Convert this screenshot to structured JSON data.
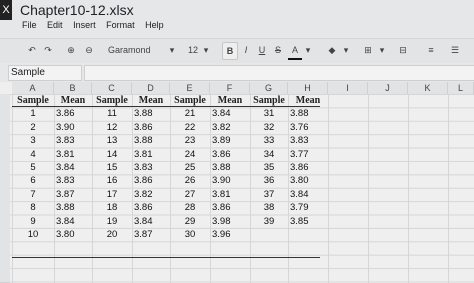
{
  "window": {
    "title": "Chapter10-12.xlsx",
    "app_icon": "X"
  },
  "menu": [
    "File",
    "Edit",
    "Insert",
    "Format",
    "Help"
  ],
  "toolbar": {
    "font": "Garamond",
    "font_size": "12",
    "bold": "B",
    "italic": "I",
    "underline": "U",
    "strike": "S",
    "font_color": "A"
  },
  "namebox": {
    "value": "Sample"
  },
  "columns": [
    "A",
    "B",
    "C",
    "D",
    "E",
    "F",
    "G",
    "H",
    "I",
    "J",
    "K",
    "L"
  ],
  "table": {
    "headers": [
      "Sample",
      "Mean",
      "Sample",
      "Mean",
      "Sample",
      "Mean",
      "Sample",
      "Mean"
    ],
    "rows": [
      [
        "1",
        "3.86",
        "11",
        "3.88",
        "21",
        "3.84",
        "31",
        "3.88"
      ],
      [
        "2",
        "3.90",
        "12",
        "3.86",
        "22",
        "3.82",
        "32",
        "3.76"
      ],
      [
        "3",
        "3.83",
        "13",
        "3.88",
        "23",
        "3.89",
        "33",
        "3.83"
      ],
      [
        "4",
        "3.81",
        "14",
        "3.81",
        "24",
        "3.86",
        "34",
        "3.77"
      ],
      [
        "5",
        "3.84",
        "15",
        "3.83",
        "25",
        "3.88",
        "35",
        "3.86"
      ],
      [
        "6",
        "3.83",
        "16",
        "3.86",
        "26",
        "3.90",
        "36",
        "3.80"
      ],
      [
        "7",
        "3.87",
        "17",
        "3.82",
        "27",
        "3.81",
        "37",
        "3.84"
      ],
      [
        "8",
        "3.88",
        "18",
        "3.86",
        "28",
        "3.86",
        "38",
        "3.79"
      ],
      [
        "9",
        "3.84",
        "19",
        "3.84",
        "29",
        "3.98",
        "39",
        "3.85"
      ],
      [
        "10",
        "3.80",
        "20",
        "3.87",
        "30",
        "3.96",
        "",
        ""
      ]
    ]
  }
}
